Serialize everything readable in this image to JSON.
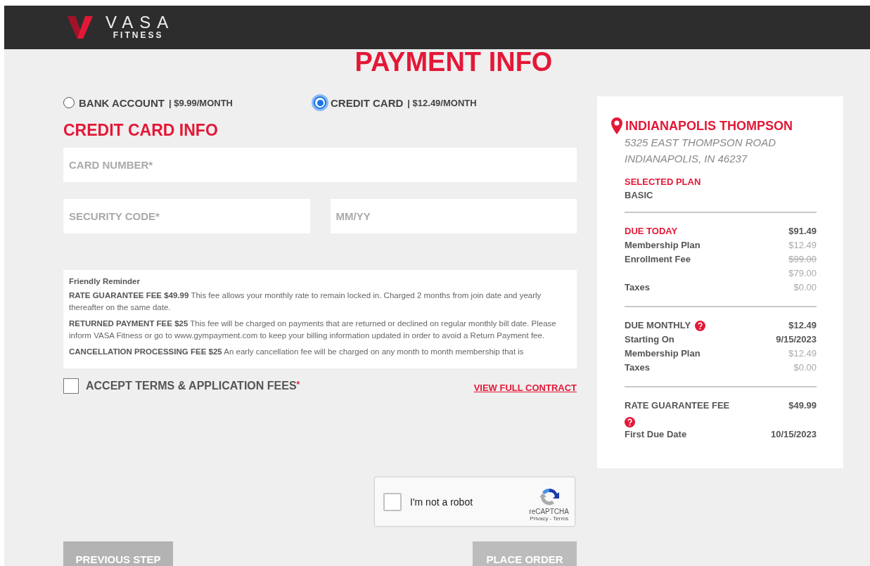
{
  "header": {
    "logo_word": "VASA",
    "logo_sub": "FITNESS"
  },
  "title": "PAYMENT INFO",
  "payment_options": [
    {
      "label": "BANK ACCOUNT",
      "price": "| $9.99/MONTH",
      "selected": false
    },
    {
      "label": "CREDIT CARD",
      "price": "| $12.49/MONTH",
      "selected": true
    }
  ],
  "section_title": "CREDIT CARD INFO",
  "fields": {
    "card_number": {
      "placeholder": "CARD NUMBER*"
    },
    "security_code": {
      "placeholder": "SECURITY CODE*"
    },
    "expiry": {
      "placeholder": "MM/YY"
    }
  },
  "reminder": {
    "title": "Friendly Reminder",
    "paragraphs": [
      "**RATE GUARANTEE FEE $49.99** This fee allows your monthly rate to remain locked in. Charged 2 months from join date and yearly thereafter on the same date.",
      "**RETURNED PAYMENT FEE $25** This fee will be charged on payments that are returned or declined on regular monthly bill date. Please inform VASA Fitness or go to www.gympayment.com to keep your billing information updated in order to avoid a Return Payment fee.",
      "**CANCELLATION PROCESSING FEE $25** An early cancellation fee will be charged on any month to month membership that is"
    ]
  },
  "terms": {
    "label": "ACCEPT TERMS & APPLICATION FEES",
    "required_mark": "*",
    "checked": false
  },
  "contract_link": "VIEW FULL CONTRACT",
  "captcha": {
    "label": "I'm not a robot",
    "brand": "reCAPTCHA",
    "links": "Privacy - Terms",
    "checked": false
  },
  "buttons": [
    {
      "label": "PREVIOUS STEP",
      "kind": "secondary",
      "disabled": false
    },
    {
      "label": "PLACE ORDER",
      "kind": "primary",
      "disabled": true
    }
  ],
  "summary": {
    "location": "INDIANAPOLIS THOMPSON",
    "address": [
      "5325 EAST THOMPSON ROAD",
      "INDIANAPOLIS, IN 46237"
    ],
    "plan_label": "SELECTED PLAN",
    "plan": "BASIC",
    "sections": [
      {
        "rows": [
          {
            "kind": "heading",
            "label": "DUE TODAY",
            "value": "$91.49",
            "help": false
          },
          {
            "kind": "item",
            "label": "Membership Plan",
            "value": "$12.49",
            "muted": true,
            "struck": false
          },
          {
            "kind": "item",
            "label": "Enrollment Fee",
            "value": "$99.00",
            "muted": true,
            "struck": true
          },
          {
            "kind": "item",
            "value": "$79.00",
            "muted": true,
            "struck": false
          },
          {
            "kind": "item",
            "label": "Taxes",
            "value": "$0.00",
            "muted": true,
            "struck": false
          }
        ]
      },
      {
        "rows": [
          {
            "kind": "plain-heading",
            "label": "DUE MONTHLY",
            "value": "$12.49",
            "help": true
          },
          {
            "kind": "item",
            "label": "Starting On",
            "value": "9/15/2023",
            "muted": false,
            "struck": false
          },
          {
            "kind": "item",
            "label": "Membership Plan",
            "value": "$12.49",
            "muted": true,
            "struck": false
          },
          {
            "kind": "item",
            "label": "Taxes",
            "value": "$0.00",
            "muted": true,
            "struck": false
          }
        ]
      },
      {
        "rows": [
          {
            "kind": "plain-heading",
            "label": "RATE GUARANTEE FEE",
            "value": "$49.99",
            "help": true
          },
          {
            "kind": "item",
            "label": "First Due Date",
            "value": "10/15/2023",
            "muted": false,
            "struck": false
          }
        ]
      }
    ]
  }
}
